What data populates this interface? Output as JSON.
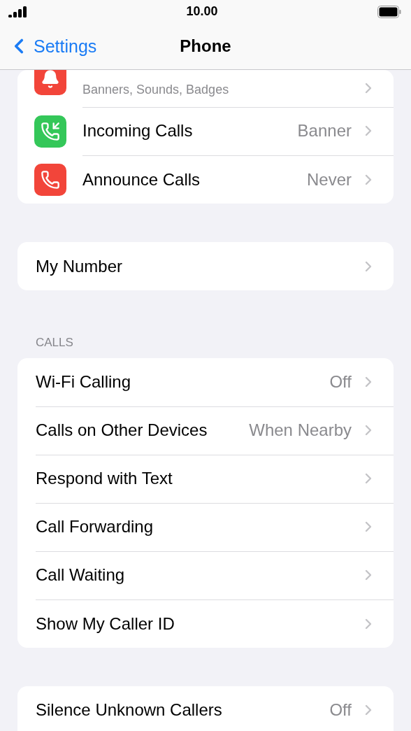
{
  "status_bar": {
    "time": "10.00"
  },
  "nav": {
    "back": "Settings",
    "title": "Phone"
  },
  "sections": [
    {
      "rows": [
        {
          "kind": "notification",
          "color": "#f2453a",
          "subtitle": "Banners, Sounds, Badges"
        },
        {
          "kind": "incoming",
          "color": "#34c759",
          "label": "Incoming Calls",
          "value": "Banner"
        },
        {
          "kind": "announce",
          "color": "#f2453a",
          "label": "Announce Calls",
          "value": "Never"
        }
      ]
    },
    {
      "rows": [
        {
          "kind": "plain",
          "label": "My Number"
        }
      ]
    },
    {
      "header": "CALLS",
      "rows": [
        {
          "kind": "plain",
          "label": "Wi-Fi Calling",
          "value": "Off"
        },
        {
          "kind": "plain",
          "label": "Calls on Other Devices",
          "value": "When Nearby"
        },
        {
          "kind": "plain",
          "label": "Respond with Text"
        },
        {
          "kind": "plain",
          "label": "Call Forwarding"
        },
        {
          "kind": "plain",
          "label": "Call Waiting"
        },
        {
          "kind": "plain",
          "label": "Show My Caller ID"
        }
      ]
    },
    {
      "rows": [
        {
          "kind": "plain",
          "label": "Silence Unknown Callers",
          "value": "Off"
        }
      ]
    }
  ]
}
